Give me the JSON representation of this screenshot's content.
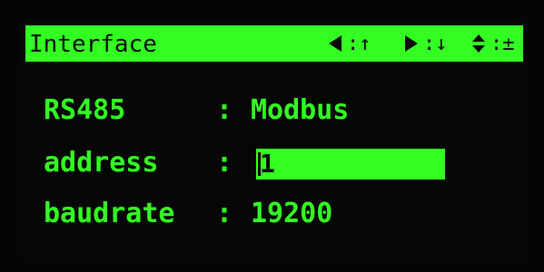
{
  "header": {
    "title": "Interface",
    "hints": [
      {
        "icon": "arrow-left-icon",
        "symbol": "↑"
      },
      {
        "icon": "arrow-right-icon",
        "symbol": "↓"
      },
      {
        "icon": "arrow-updown-icon",
        "symbol": "±"
      }
    ]
  },
  "settings": [
    {
      "label": "RS485",
      "separator": ":",
      "value": "Modbus"
    },
    {
      "label": "address",
      "separator": ":",
      "value": "1"
    },
    {
      "label": "baudrate",
      "separator": ":",
      "value": "19200"
    }
  ],
  "colors": {
    "foreground": "#33ff22",
    "background": "#050705"
  }
}
